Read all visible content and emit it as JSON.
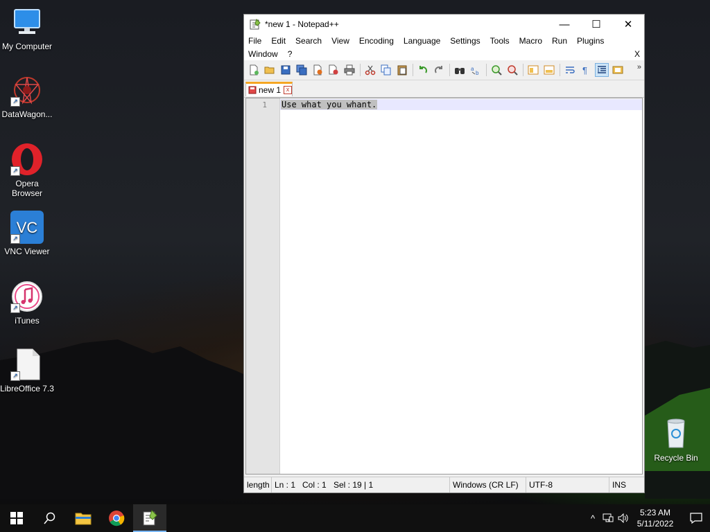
{
  "desktop": {
    "icons": [
      {
        "label": "My Computer"
      },
      {
        "label": "DataWagon..."
      },
      {
        "label": "Opera Browser"
      },
      {
        "label": "VNC Viewer"
      },
      {
        "label": "iTunes"
      },
      {
        "label": "LibreOffice 7.3"
      },
      {
        "label": "Recycle Bin"
      }
    ]
  },
  "window": {
    "title": "*new 1 - Notepad++",
    "controls": {
      "minimize": "—",
      "maximize": "☐",
      "close": "✕"
    },
    "menu_row1": [
      "File",
      "Edit",
      "Search",
      "View",
      "Encoding",
      "Language",
      "Settings",
      "Tools",
      "Macro",
      "Run",
      "Plugins"
    ],
    "menu_row2": [
      "Window",
      "?"
    ],
    "menu_close": "X",
    "toolbar_more": "»",
    "tab": {
      "label": "new 1",
      "close": "x"
    },
    "editor": {
      "line_number": "1",
      "text": "Use what you whant."
    },
    "status": {
      "length": "length",
      "ln": "Ln : 1",
      "col": "Col : 1",
      "sel": "Sel : 19 | 1",
      "eol": "Windows (CR LF)",
      "encoding": "UTF-8",
      "mode": "INS"
    }
  },
  "taskbar": {
    "clock_time": "5:23 AM",
    "clock_date": "5/11/2022",
    "tray_chevron": "^"
  },
  "colors": {
    "tab_accent": "#f5a623",
    "selection": "#c0c0c0",
    "current_line": "#e8e8ff",
    "taskbar": "#101010"
  }
}
